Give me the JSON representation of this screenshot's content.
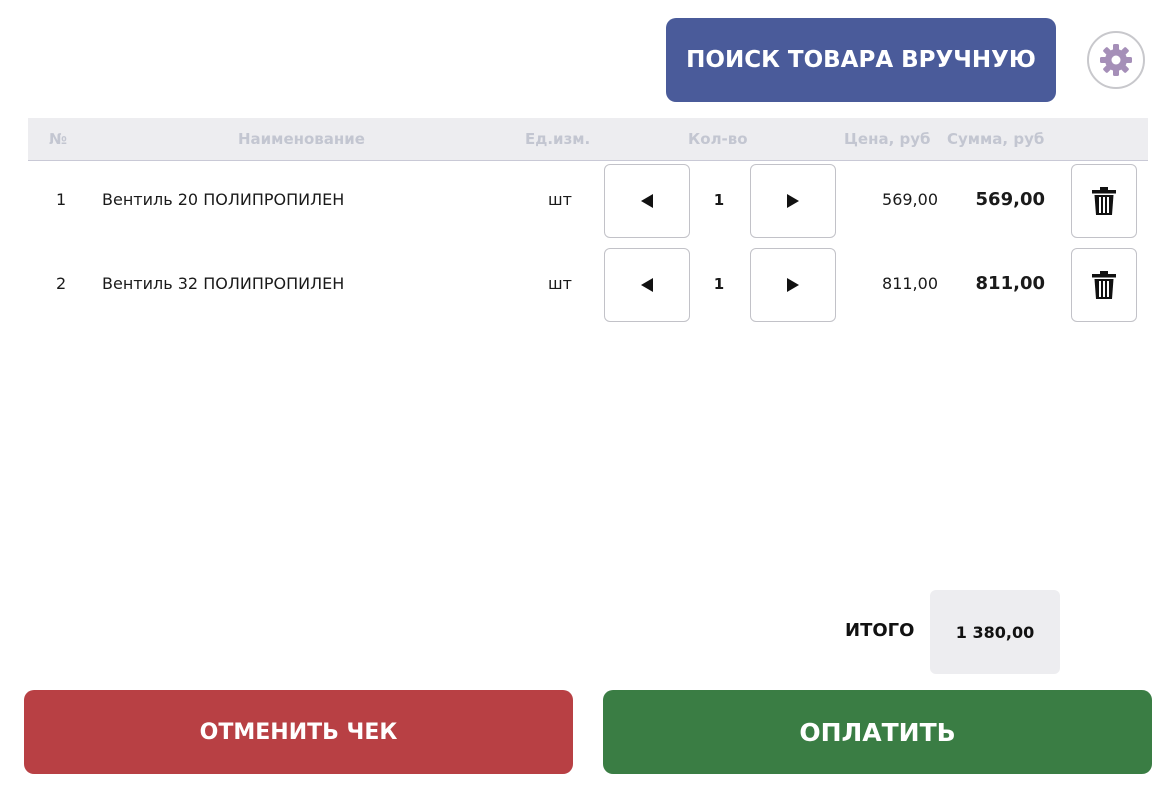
{
  "toolbar": {
    "search_label": "ПОИСК ТОВАРА ВРУЧНУЮ",
    "settings_icon": "gear-icon"
  },
  "table": {
    "headers": {
      "num": "№",
      "name": "Наименование",
      "unit": "Ед.изм.",
      "qty": "Кол-во",
      "price": "Цена, руб",
      "sum": "Сумма, руб"
    },
    "rows": [
      {
        "num": "1",
        "name": "Вентиль 20 ПОЛИПРОПИЛЕН",
        "unit": "шт",
        "qty": "1",
        "price": "569,00",
        "sum": "569,00"
      },
      {
        "num": "2",
        "name": "Вентиль 32 ПОЛИПРОПИЛЕН",
        "unit": "шт",
        "qty": "1",
        "price": "811,00",
        "sum": "811,00"
      }
    ]
  },
  "totals": {
    "label": "ИТОГО",
    "value": "1 380,00"
  },
  "actions": {
    "cancel_label": "ОТМЕНИТЬ ЧЕК",
    "pay_label": "ОПЛАТИТЬ"
  },
  "colors": {
    "search_button": "#4a5b9a",
    "cancel_button": "#b84044",
    "pay_button": "#3a7d44",
    "header_bg": "#ededf0",
    "header_text": "#c3c6d1"
  }
}
